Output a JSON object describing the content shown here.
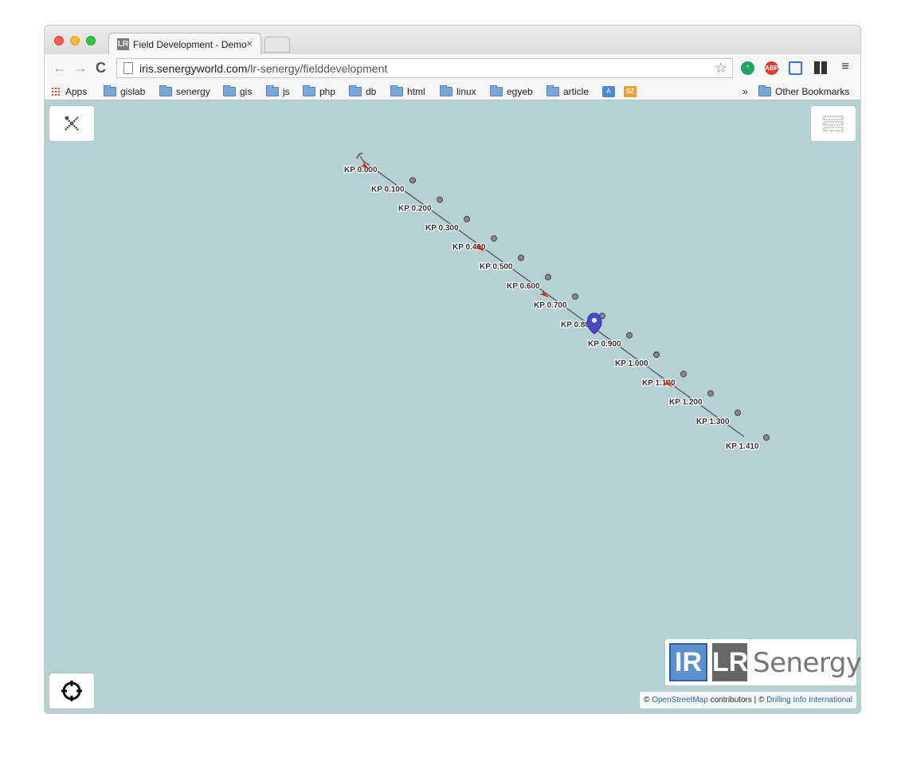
{
  "browser": {
    "tab_title": "Field Development - Demo",
    "tab_favicon": "LR",
    "tab_close": "×",
    "nav": {
      "back": "←",
      "forward": "→",
      "reload": "C"
    },
    "url_host": "iris.senergyworld.com",
    "url_path": "/lr-senergy/fielddevelopment",
    "extensions": {
      "hangouts": "”",
      "abp": "ABP",
      "menu": "≡"
    },
    "bookmarks": [
      {
        "label": "Apps",
        "icon": "apps-grid-icon"
      },
      {
        "label": "gislab",
        "icon": "folder-icon"
      },
      {
        "label": "senergy",
        "icon": "folder-icon"
      },
      {
        "label": "gis",
        "icon": "folder-icon"
      },
      {
        "label": "js",
        "icon": "folder-icon"
      },
      {
        "label": "php",
        "icon": "folder-icon"
      },
      {
        "label": "db",
        "icon": "folder-icon"
      },
      {
        "label": "html",
        "icon": "folder-icon"
      },
      {
        "label": "linux",
        "icon": "folder-icon"
      },
      {
        "label": "egyeb",
        "icon": "folder-icon"
      },
      {
        "label": "article",
        "icon": "folder-icon"
      }
    ],
    "bookmark_translate": "A",
    "bookmark_sz": "SZ",
    "bookmark_overflow": "»",
    "other_bookmarks": "Other Bookmarks"
  },
  "map": {
    "kp_labels": [
      "KP 0.000",
      "KP 0.100",
      "KP 0.200",
      "KP 0.300",
      "KP 0.400",
      "KP 0.500",
      "KP 0.600",
      "KP 0.700",
      "KP 0.800",
      "KP 0.900",
      "KP 1.000",
      "KP 1.100",
      "KP 1.200",
      "KP 1.300",
      "KP 1.410"
    ],
    "line_color": "#555555",
    "arrow_color": "#e0201c",
    "marker_color": "#4a4ac8",
    "background_color": "#b6d1d1"
  },
  "logo": {
    "text": "Senergy",
    "mark_1": "IR",
    "mark_2": "LR"
  },
  "attribution": {
    "copyright": "©",
    "osm": "OpenStreetMap",
    "contributors": "contributors | ©",
    "drilling": "Drilling Info International"
  }
}
